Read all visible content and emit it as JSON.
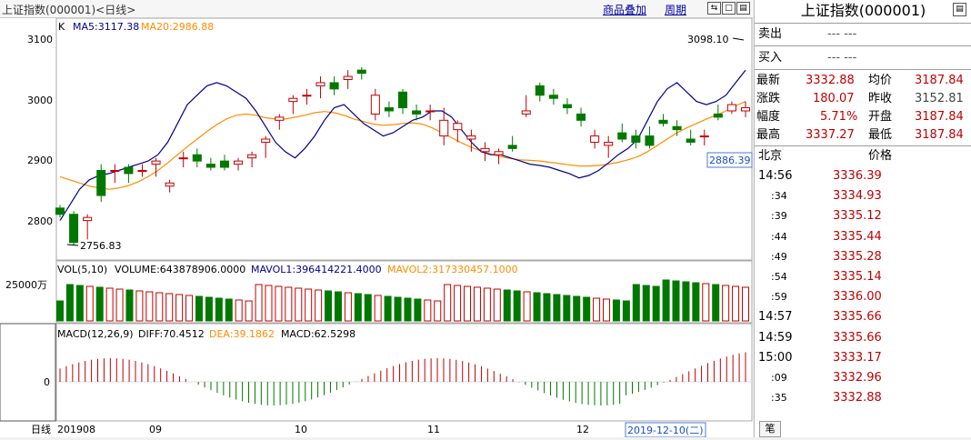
{
  "window": {
    "title": "上证指数(000001)<日线>",
    "links": [
      "商品叠加",
      "周期"
    ]
  },
  "kline": {
    "label": "K",
    "ma5": "MA5:3117.38",
    "ma20": "MA20:2986.88",
    "high_label": "3098.10",
    "low_label": "2756.83",
    "price_tag": "2886.39",
    "y_ticks": [
      "3100",
      "3000",
      "2900",
      "2800"
    ]
  },
  "volume": {
    "header_vol": "VOL(5,10)",
    "header_volume": "VOLUME:643878906.0000",
    "header_mavol1": "MAVOL1:396414221.4000",
    "header_mavol2": "MAVOL2:317330457.1000",
    "y_tick": "25000万"
  },
  "macd": {
    "header_name": "MACD(12,26,9)",
    "header_diff": "DIFF:70.4512",
    "header_dea": "DEA:39.1862",
    "header_macd": "MACD:62.5298",
    "y_tick": "0"
  },
  "x_axis": {
    "period_label": "日线",
    "labels": [
      "201908",
      "09",
      "10",
      "11",
      "12"
    ],
    "cursor_date": "2019-12-10(二)"
  },
  "colors": {
    "up": "#c00000",
    "down": "#007800",
    "ma5": "#00008b",
    "ma20": "#ff8c00",
    "link": "#00009c"
  },
  "quote": {
    "title": "上证指数(000001)",
    "sell_label": "卖出",
    "sell_value": "---  ---",
    "buy_label": "买入",
    "buy_value": "---  ---",
    "stats": [
      {
        "k1": "最新",
        "v1": "3332.88",
        "k2": "均价",
        "v2": "3187.84"
      },
      {
        "k1": "涨跌",
        "v1": "180.07",
        "k2": "昨收",
        "v2": "3152.81"
      },
      {
        "k1": "幅度",
        "v1": "5.71%",
        "k2": "开盘",
        "v2": "3187.84"
      },
      {
        "k1": "最高",
        "v1": "3337.27",
        "k2": "最低",
        "v2": "3187.84"
      }
    ],
    "ticks_header_left": "北京",
    "ticks_header_right": "价格",
    "ticks": [
      {
        "t": "14:56",
        "p": "3336.39"
      },
      {
        "t": ":34",
        "p": "3334.93"
      },
      {
        "t": ":39",
        "p": "3335.12"
      },
      {
        "t": ":44",
        "p": "3335.44"
      },
      {
        "t": ":49",
        "p": "3335.28"
      },
      {
        "t": ":54",
        "p": "3335.14"
      },
      {
        "t": ":59",
        "p": "3336.00"
      },
      {
        "t": "14:57",
        "p": "3335.66"
      },
      {
        "t": "14:59",
        "p": "3335.66"
      },
      {
        "t": "15:00",
        "p": "3333.17"
      },
      {
        "t": ":09",
        "p": "3332.96"
      },
      {
        "t": ":35",
        "p": "3332.88"
      }
    ],
    "bottom_tab": "笔"
  },
  "chart_data": {
    "type": "candlestick",
    "y_range": [
      2740,
      3120
    ],
    "ma5": [
      2800,
      2825,
      2850,
      2865,
      2872,
      2875,
      2880,
      2885,
      2890,
      2895,
      2905,
      2925,
      2955,
      2985,
      3000,
      3015,
      3020,
      3015,
      3005,
      2995,
      2975,
      2950,
      2925,
      2910,
      2900,
      2915,
      2935,
      2960,
      2980,
      2985,
      2970,
      2955,
      2945,
      2935,
      2940,
      2950,
      2960,
      2965,
      2975,
      2975,
      2965,
      2945,
      2925,
      2910,
      2905,
      2905,
      2900,
      2895,
      2890,
      2888,
      2885,
      2880,
      2875,
      2868,
      2872,
      2880,
      2892,
      2905,
      2915,
      2930,
      2960,
      2990,
      3010,
      3020,
      3005,
      2990,
      2985,
      2990,
      3000,
      3020,
      3040
    ],
    "ma20": [
      2870,
      2865,
      2860,
      2855,
      2852,
      2850,
      2852,
      2856,
      2862,
      2870,
      2880,
      2892,
      2905,
      2918,
      2930,
      2942,
      2953,
      2962,
      2968,
      2970,
      2968,
      2964,
      2962,
      2962,
      2965,
      2968,
      2972,
      2974,
      2972,
      2968,
      2962,
      2958,
      2954,
      2952,
      2953,
      2955,
      2956,
      2954,
      2948,
      2940,
      2932,
      2924,
      2917,
      2911,
      2906,
      2902,
      2899,
      2897,
      2896,
      2895,
      2893,
      2891,
      2889,
      2887,
      2887,
      2888,
      2890,
      2893,
      2897,
      2902,
      2910,
      2920,
      2930,
      2940,
      2948,
      2955,
      2962,
      2968,
      2975,
      2983,
      2990
    ],
    "candles_ohlc": [
      [
        2820,
        2825,
        2805,
        2810
      ],
      [
        2810,
        2815,
        2760,
        2765
      ],
      [
        2800,
        2810,
        2770,
        2805
      ],
      [
        2880,
        2890,
        2830,
        2840
      ],
      [
        2880,
        2890,
        2860,
        2880
      ],
      [
        2885,
        2890,
        2860,
        2875
      ],
      [
        2880,
        2890,
        2870,
        2880
      ],
      [
        2890,
        2900,
        2870,
        2895
      ],
      [
        2855,
        2865,
        2845,
        2860
      ],
      [
        2900,
        2910,
        2885,
        2900
      ],
      [
        2905,
        2915,
        2885,
        2895
      ],
      [
        2890,
        2900,
        2880,
        2885
      ],
      [
        2895,
        2905,
        2880,
        2885
      ],
      [
        2890,
        2900,
        2880,
        2895
      ],
      [
        2900,
        2910,
        2885,
        2905
      ],
      [
        2925,
        2935,
        2900,
        2930
      ],
      [
        2960,
        2970,
        2945,
        2965
      ],
      [
        2990,
        3000,
        2970,
        2995
      ],
      [
        3000,
        3010,
        2985,
        3000
      ],
      [
        3015,
        3030,
        2995,
        3020
      ],
      [
        3020,
        3030,
        3000,
        3010
      ],
      [
        3025,
        3040,
        3010,
        3030
      ],
      [
        3040,
        3045,
        3025,
        3035
      ],
      [
        2970,
        3010,
        2960,
        3000
      ],
      [
        2980,
        2990,
        2965,
        2975
      ],
      [
        3005,
        3010,
        2970,
        2980
      ],
      [
        2975,
        2985,
        2960,
        2970
      ],
      [
        2975,
        2985,
        2960,
        2975
      ],
      [
        2935,
        2980,
        2920,
        2960
      ],
      [
        2945,
        2960,
        2925,
        2955
      ],
      [
        2930,
        2945,
        2910,
        2935
      ],
      [
        2910,
        2925,
        2895,
        2915
      ],
      [
        2905,
        2915,
        2890,
        2910
      ],
      [
        2920,
        2935,
        2910,
        2915
      ],
      [
        2970,
        3000,
        2965,
        2975
      ],
      [
        3015,
        3020,
        2990,
        3000
      ],
      [
        3000,
        3010,
        2985,
        2995
      ],
      [
        2985,
        2995,
        2970,
        2980
      ],
      [
        2970,
        2980,
        2950,
        2960
      ],
      [
        2925,
        2945,
        2915,
        2935
      ],
      [
        2920,
        2935,
        2900,
        2925
      ],
      [
        2940,
        2955,
        2925,
        2930
      ],
      [
        2935,
        2945,
        2915,
        2925
      ],
      [
        2935,
        2950,
        2915,
        2920
      ],
      [
        2960,
        2970,
        2950,
        2955
      ],
      [
        2950,
        2960,
        2935,
        2945
      ],
      [
        2930,
        2945,
        2920,
        2925
      ],
      [
        2935,
        2945,
        2920,
        2935
      ],
      [
        2970,
        2985,
        2960,
        2965
      ],
      [
        2975,
        2990,
        2970,
        2985
      ],
      [
        2975,
        2990,
        2965,
        2980
      ]
    ],
    "x_labels": [
      "201908",
      "09",
      "10",
      "11",
      "12"
    ]
  }
}
